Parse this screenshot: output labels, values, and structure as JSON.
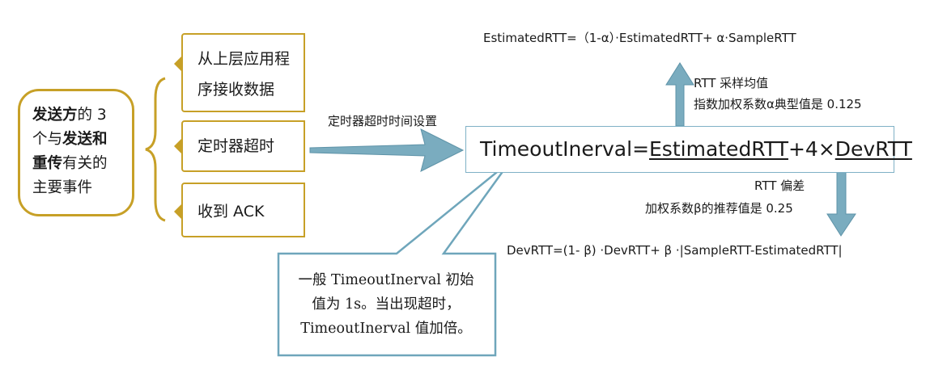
{
  "main_events": {
    "line1_bold": "发送方",
    "line1_rest": "的 3",
    "line2_pre": "个与",
    "line2_bold": "发送和",
    "line3_bold": "重传",
    "line3_rest": "有关的",
    "line4": "主要事件"
  },
  "events": [
    {
      "line1": "从上层应用程",
      "line2": "序接收数据"
    },
    {
      "line1": "定时器超时"
    },
    {
      "line1": "收到 ACK"
    }
  ],
  "timer_setting_label": "定时器超时时间设置",
  "timeout_formula": {
    "lhs": "TimeoutInerval",
    "eq": "=",
    "term1": "EstimatedRTT",
    "mid": "+4×",
    "term2": "DevRTT"
  },
  "estimated_formula": "EstimatedRTT=（1-α）·EstimatedRTT+ α·SampleRTT",
  "rtt_avg_note": {
    "line1": "RTT 采样均值",
    "line2": "指数加权系数α典型值是 0.125"
  },
  "rtt_dev_note": {
    "line1": "RTT 偏差",
    "line2": "加权系数β的推荐值是 0.25"
  },
  "dev_formula": "DevRTT=(1- β) ·DevRTT+ β ·|SampleRTT-EstimatedRTT|",
  "callout": {
    "line1": "一般 TimeoutInerval 初始",
    "line2": "值为 1s。当出现超时，",
    "line3": "TimeoutInerval 值加倍。"
  },
  "colors": {
    "gold": "#c7a027",
    "arrow_fill": "#7aacbf",
    "arrow_stroke": "#5e93a8",
    "box_border": "#7fb1c6"
  }
}
